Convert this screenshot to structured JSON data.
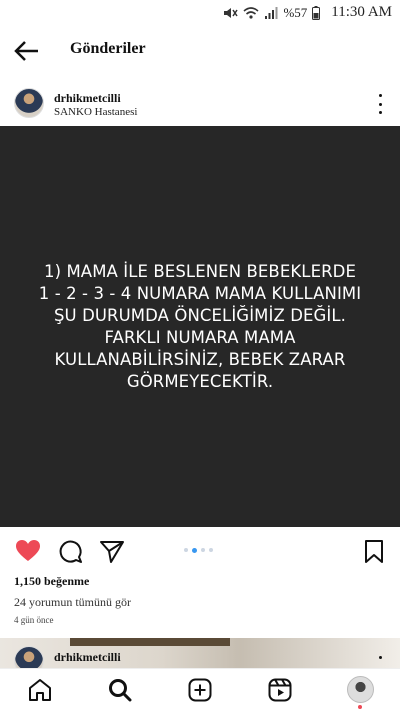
{
  "status_bar": {
    "battery": "%57",
    "time": "11:30 AM"
  },
  "header": {
    "title": "Gönderiler",
    "back_icon": "arrow-left-icon"
  },
  "post": {
    "username": "drhikmetcilli",
    "location": "SANKO Hastanesi",
    "image_text": "1) MAMA İLE BESLENEN BEBEKLERDE\n1 - 2 - 3 - 4 NUMARA MAMA KULLANIMI\nŞU DURUMDA ÖNCELİĞİMİZ DEĞİL.\nFARKLI NUMARA MAMA\nKULLANABİLİRSİNİZ, BEBEK ZARAR\nGÖRMEYECEKTİR.",
    "liked": true,
    "carousel_count": 4,
    "carousel_active": 2,
    "likes": "1,150 beğenme",
    "comments_link": "24 yorumun tümünü gör",
    "time_ago": "4 gün önce"
  },
  "next_post": {
    "username": "drhikmetcilli"
  },
  "bottom_nav": {
    "items": [
      "home-icon",
      "search-icon",
      "create-icon",
      "reels-icon",
      "profile-avatar"
    ],
    "active": "search-icon"
  },
  "colors": {
    "like": "#ed4956",
    "accent": "#3897f0",
    "image_bg": "#272727"
  }
}
